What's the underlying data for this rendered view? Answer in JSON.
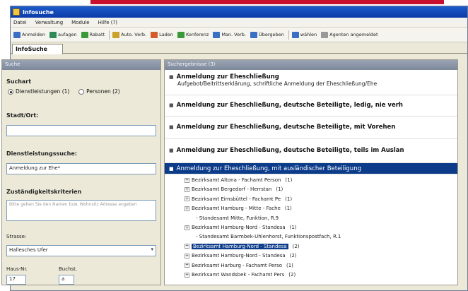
{
  "window": {
    "title": "Infosuche"
  },
  "menu": [
    "Datei",
    "Verwaltung",
    "Module",
    "Hilfe (?)"
  ],
  "toolbar": [
    {
      "label": "Anmelden",
      "icon": "login-icon",
      "color": "#3b6fc4"
    },
    {
      "label": "aufagen",
      "icon": "clipboard-icon",
      "color": "#2e8b57"
    },
    {
      "label": "Rabatt",
      "icon": "person-icon",
      "color": "#3a9a3a"
    },
    {
      "label": "Auto. Verb.",
      "icon": "link-icon",
      "color": "#caa12a"
    },
    {
      "label": "Laden",
      "icon": "folder-icon",
      "color": "#d35a2a"
    },
    {
      "label": "Konferenz",
      "icon": "network-icon",
      "color": "#3a9a3a"
    },
    {
      "label": "Man. Verb.",
      "icon": "document-icon",
      "color": "#3b6fc4"
    },
    {
      "label": "Übergeben",
      "icon": "transfer-icon",
      "color": "#3b6fc4"
    },
    {
      "label": "wählen",
      "icon": "phone-icon",
      "color": "#3b6fc4"
    },
    {
      "label": "Agenten angemeldet",
      "icon": "agent-icon",
      "color": "#999999"
    }
  ],
  "tabs": {
    "active": "InfoSuche"
  },
  "search_panel": {
    "header": "Suche",
    "suchart_label": "Suchart",
    "radio_services": "Dienstleistungen (1)",
    "radio_persons": "Personen (2)",
    "city_label": "Stadt/Ort:",
    "city_value": "",
    "service_label": "Dienstleistungssuche:",
    "service_value": "Anmeldung zur Ehe*",
    "criteria_label": "Zuständigkeitskriterien",
    "criteria_placeholder": "Bitte geben Sie den Namen bzw. Wohnsitz Adresse angeben",
    "street_label": "Strasse:",
    "street_value": "Hallesches Ufer",
    "house_label": "Haus-Nr.",
    "house_value": "17",
    "letter_label": "Buchst.",
    "letter_value": "a"
  },
  "results_panel": {
    "header": "Suchergebnisse (3)",
    "results": [
      {
        "title": "Anmeldung zur Eheschließung",
        "subtitle": "Aufgebot/Beitrittserklärung, schriftliche Anmeldung der Eheschließung/Ehe"
      },
      {
        "title": "Anmeldung zur Eheschließung, deutsche Beteiligte, ledig, nie verh"
      },
      {
        "title": "Anmeldung zur Eheschließung, deutsche Beteiligte, mit Vorehen"
      },
      {
        "title": "Anmeldung zur Eheschließung, deutsche Beteiligte, teils im Auslan"
      },
      {
        "title": "Anmeldung zur Eheschließung, mit ausländischer Beteiligung"
      }
    ],
    "tree": [
      {
        "label": "Bezirksamt Altona - Fachamt Person",
        "count": "(1)"
      },
      {
        "label": "Bezirksamt Bergedorf - Herrstan",
        "count": "(1)"
      },
      {
        "label": "Bezirksamt Eimsbüttel - Fachamt Pe",
        "count": "(1)"
      },
      {
        "label": "Bezirksamt Hamburg - Mitte - Fache",
        "count": "(1)"
      },
      {
        "label": "Standesamt Mitte, Funktion, R.9",
        "count": "",
        "child": true
      },
      {
        "label": "Bezirksamt Hamburg-Nord - Standesa",
        "count": "(1)"
      },
      {
        "label": "Standesamt Barmbek-Uhlenhorst, Funktionspostfach, R.1",
        "count": "",
        "child": true
      },
      {
        "label": "Bezirksamt Hamburg-Nord - Standesa",
        "count": "(2)",
        "highlight": true
      },
      {
        "label": "Bezirksamt Hamburg-Nord - Standesa",
        "count": "(2)"
      },
      {
        "label": "Bezirksamt Harburg - Fachamt Perso",
        "count": "(1)"
      },
      {
        "label": "Bezirksamt Wandsbek - Fachamt Pers",
        "count": "(2)"
      }
    ]
  },
  "colors": {
    "accent": "#c8102e",
    "selection": "#0c3b8a",
    "titlebar": "#1c5cc9"
  }
}
